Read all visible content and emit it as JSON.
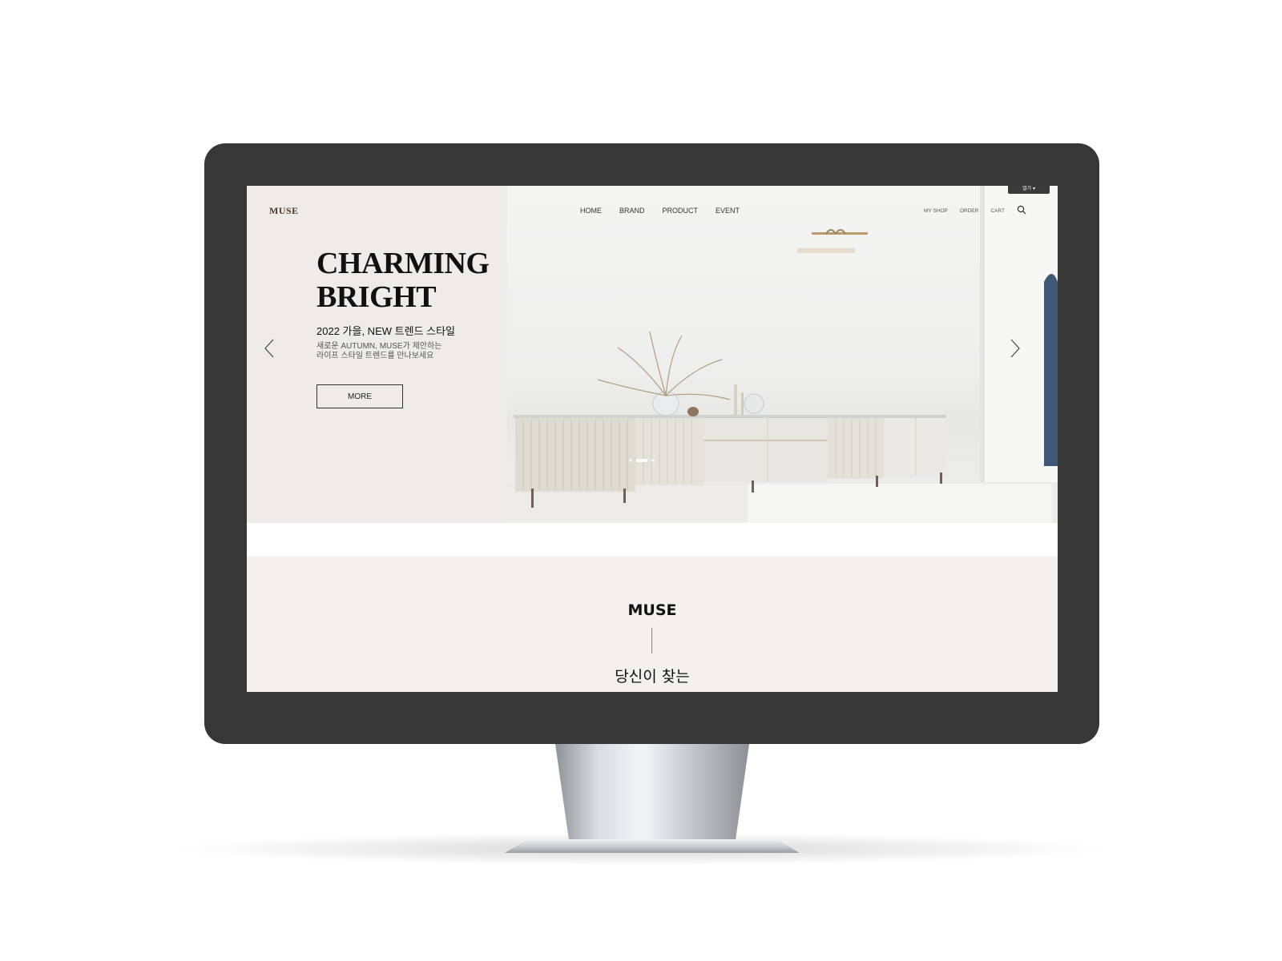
{
  "header": {
    "logo": "MUSE",
    "nav": [
      "HOME",
      "BRAND",
      "PRODUCT",
      "EVENT"
    ],
    "util": [
      "MY SHOP",
      "ORDER",
      "CART"
    ],
    "open_button": "열기 ▾"
  },
  "hero": {
    "title_line1": "CHARMING",
    "title_line2": "BRIGHT",
    "subtitle": "2022 가을, NEW 트렌드 스타일",
    "desc_line1": "새로운 AUTUMN, MUSE가 제안하는",
    "desc_line2": "라이프 스타일 트렌드를 만나보세요",
    "more_label": "MORE",
    "slide_count": 3,
    "active_slide": 2
  },
  "intro": {
    "title": "MUSE",
    "subtitle": "당신이 찾는"
  },
  "icons": {
    "prev": "chevron-left-icon",
    "next": "chevron-right-icon",
    "search": "search-icon"
  },
  "colors": {
    "hero_bg": "#eeebe8",
    "intro_bg": "#f3f0ed",
    "bezel": "#373737"
  }
}
